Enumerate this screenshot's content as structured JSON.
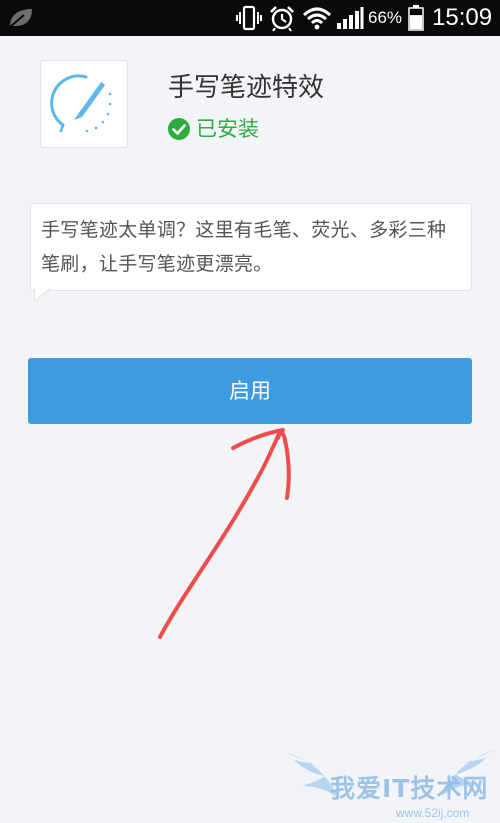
{
  "status_bar": {
    "battery_percent": "66%",
    "time": "15:09",
    "icons": [
      "leaf-icon",
      "vibrate-icon",
      "alarm-icon",
      "wifi-icon",
      "signal-icon",
      "battery-icon"
    ],
    "battery_level": 0.66
  },
  "app": {
    "title": "手写笔迹特效",
    "status": "已安装",
    "icon": "pen-stroke-icon",
    "status_icon": "check-circle-icon"
  },
  "description": {
    "text": "手写笔迹太单调？这里有毛笔、荧光、多彩三种笔刷，让手写笔迹更漂亮。"
  },
  "enable_button": {
    "label": "启用"
  },
  "watermark": {
    "text": "我爱IT技术网",
    "url": "www.52ij.com"
  },
  "colors": {
    "status_bar_bg": "#0a0a0a",
    "page_bg": "#f3f4f8",
    "button_bg": "#3d9be0",
    "installed_green": "#2dac3f",
    "icon_blue": "#5db7ea",
    "annotation_red": "#ef4d4d"
  }
}
